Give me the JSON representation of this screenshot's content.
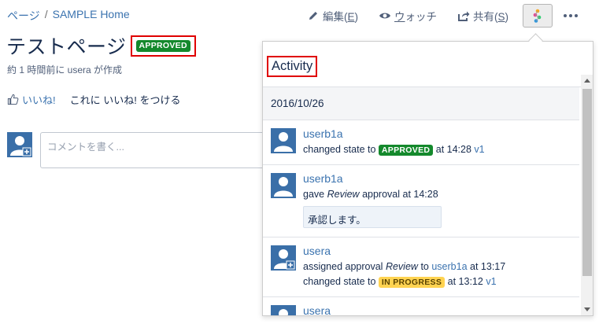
{
  "breadcrumb": {
    "items": [
      "ページ",
      "SAMPLE Home"
    ],
    "separator": "/"
  },
  "toolbar": {
    "edit_label": "編集(",
    "edit_key": "E",
    "edit_suffix": ")",
    "watch_prefix": "",
    "watch_key": "ウ",
    "watch_suffix": "ォッチ",
    "share_label": "共有(",
    "share_key": "S",
    "share_suffix": ")"
  },
  "page": {
    "title": "テストページ",
    "status_badge": "APPROVED",
    "meta": "約 1 時間前に usera が作成"
  },
  "like": {
    "link": "いいね!",
    "prompt": "これに いいね! をつける"
  },
  "comment": {
    "placeholder": "コメントを書く..."
  },
  "activity": {
    "title": "Activity",
    "date": "2016/10/26",
    "entries": [
      {
        "user": "userb1a",
        "line1_pre": "changed state to",
        "line1_badge": "APPROVED",
        "line1_post": "at 14:28",
        "line1_link": "v1"
      },
      {
        "user": "userb1a",
        "line1_pre": "gave",
        "line1_em": "Review",
        "line1_post": "approval at 14:28",
        "quote": "承認します。"
      },
      {
        "user": "usera",
        "line1_pre": "assigned approval",
        "line1_em": "Review",
        "line1_mid": "to",
        "line1_link": "userb1a",
        "line1_post": "at 13:17",
        "line2_pre": "changed state to",
        "line2_badge": "IN PROGRESS",
        "line2_post": "at 13:12",
        "line2_link": "v1"
      },
      {
        "user": "usera"
      }
    ]
  },
  "colors": {
    "link": "#3b73af",
    "approved": "#14892c",
    "in_progress": "#ffd351",
    "highlight_border": "#e00000"
  },
  "icons": [
    "pencil-icon",
    "eye-icon",
    "share-icon",
    "app-icon",
    "more-icon",
    "thumbs-up-icon",
    "user-avatar-icon"
  ]
}
